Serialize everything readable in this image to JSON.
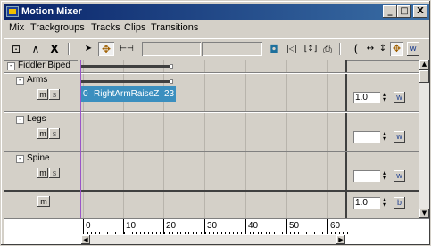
{
  "window": {
    "title": "Motion Mixer",
    "minimize_glyph": "_",
    "maximize_glyph": "□",
    "close_glyph": "X"
  },
  "menu": [
    {
      "label": "Mix"
    },
    {
      "label": "Trackgroups"
    },
    {
      "label": "Tracks"
    },
    {
      "label": "Clips"
    },
    {
      "label": "Transitions"
    }
  ],
  "toolbar": {
    "tools": [
      {
        "name": "set-range-icon",
        "glyph": "⊡"
      },
      {
        "name": "pin-icon",
        "glyph": "⊼"
      },
      {
        "name": "delete-icon",
        "glyph": "X"
      },
      {
        "name": "select-arrow-icon",
        "glyph": "➤"
      },
      {
        "name": "move-icon",
        "glyph": "✥"
      },
      {
        "name": "scale-horizontal-icon",
        "glyph": "⊢⊣"
      },
      {
        "name": "add-clip-icon",
        "glyph": "◘"
      },
      {
        "name": "insert-icon",
        "glyph": "|◁|"
      },
      {
        "name": "fit-icon",
        "glyph": "[↕]"
      },
      {
        "name": "print-icon",
        "glyph": "⎙"
      },
      {
        "name": "arc-icon",
        "glyph": "("
      },
      {
        "name": "horizontal-zoom-icon",
        "glyph": "↔"
      },
      {
        "name": "vertical-zoom-icon",
        "glyph": "↕"
      },
      {
        "name": "pan-icon",
        "glyph": "✥"
      },
      {
        "name": "weight-icon",
        "glyph": "w"
      }
    ]
  },
  "tracks": {
    "biped": {
      "label": "Fiddler Biped",
      "toggle": "-"
    },
    "groups": [
      {
        "label": "Arms",
        "toggle": "-",
        "m": "m",
        "s": "s",
        "weight": "1.0",
        "w": "w"
      },
      {
        "label": "Legs",
        "toggle": "-",
        "m": "m",
        "s": "s",
        "weight": "",
        "w": "w"
      },
      {
        "label": "Spine",
        "toggle": "-",
        "m": "m",
        "s": "s",
        "weight": "",
        "w": "w"
      }
    ],
    "balance": {
      "m": "m",
      "weight": "1.0",
      "b": "b"
    }
  },
  "clip": {
    "start": "0",
    "name": "RightArmRaiseZ",
    "end": "23",
    "color": "#3b8fbf"
  },
  "ruler": {
    "ticks": [
      "0",
      "10",
      "20",
      "30",
      "40",
      "50",
      "60"
    ]
  },
  "colors": {
    "playhead": "#9a55c8",
    "titlebar_start": "#0a246a",
    "titlebar_end": "#3a6ea5"
  }
}
